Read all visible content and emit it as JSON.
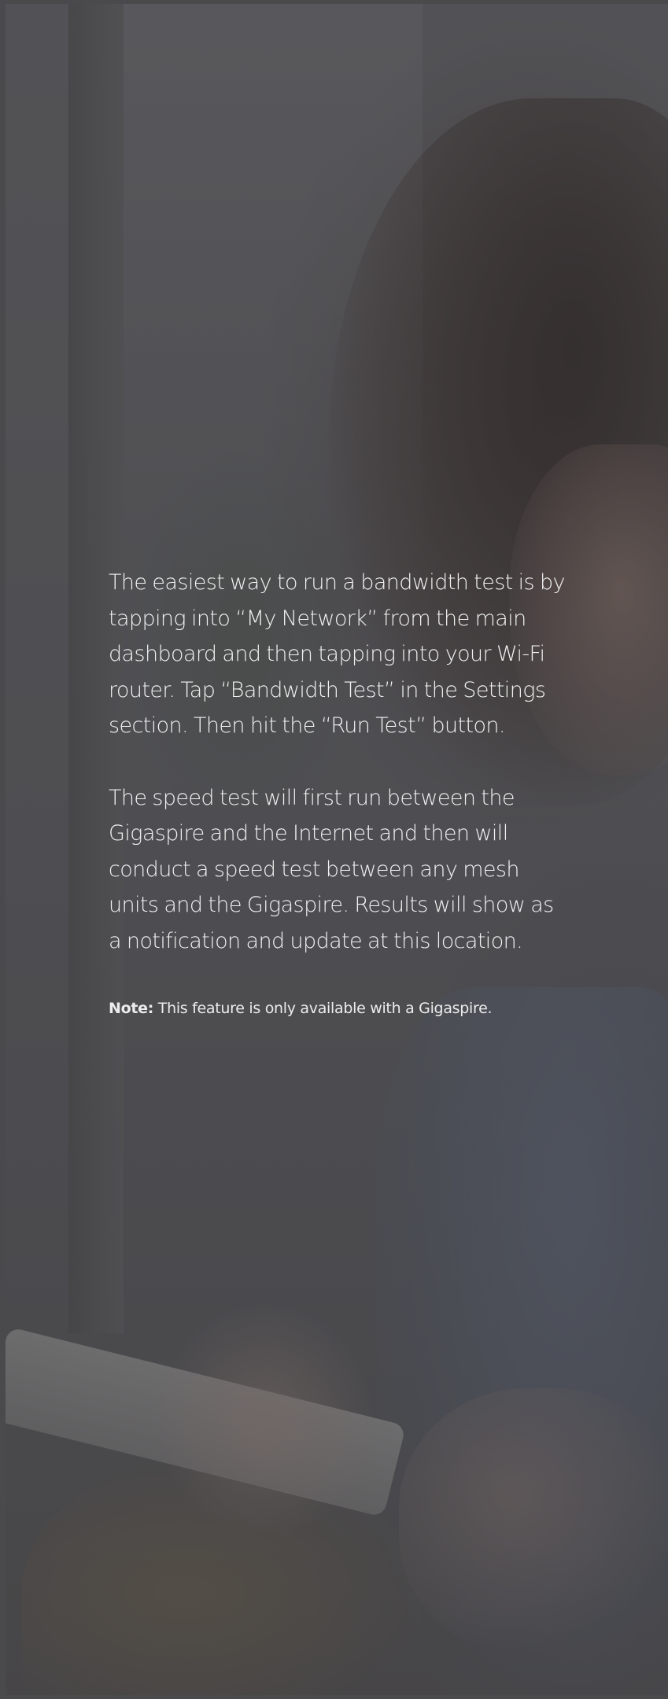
{
  "content": {
    "paragraph_1": "The easiest way to run a bandwidth test is by tapping into “My Network” from the main dashboard and then tapping into your Wi-Fi router. Tap “Bandwidth Test” in the Settings section. Then hit the “Run Test” button.",
    "paragraph_2": "The speed test will first run between the Gigaspire and the Internet and then will conduct a speed test between any mesh units and the Gigaspire. Results will show as a notification and update at this location.",
    "note_label": "Note:",
    "note_text": " This feature is only available with a Gigaspire."
  },
  "colors": {
    "overlay": "#58585c",
    "text": "#f1f1f1"
  }
}
